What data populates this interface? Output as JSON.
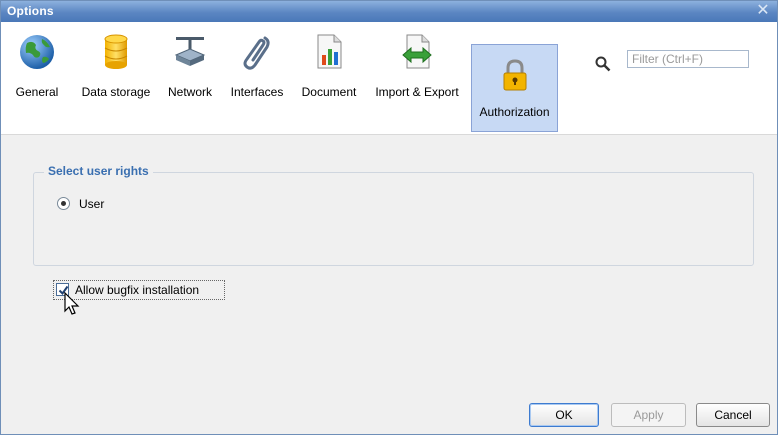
{
  "window": {
    "title": "Options"
  },
  "toolbar": {
    "items": [
      {
        "label": "General",
        "icon": "globe-icon"
      },
      {
        "label": "Data storage",
        "icon": "database-icon"
      },
      {
        "label": "Network",
        "icon": "network-icon"
      },
      {
        "label": "Interfaces",
        "icon": "paperclip-icon"
      },
      {
        "label": "Document",
        "icon": "document-chart-icon"
      },
      {
        "label": "Import & Export",
        "icon": "import-export-icon"
      },
      {
        "label": "Authorization",
        "icon": "lock-icon",
        "selected": true
      }
    ],
    "filter_placeholder": "Filter (Ctrl+F)"
  },
  "user_rights": {
    "group_title": "Select user rights",
    "radio_label": "User",
    "radio_selected": true
  },
  "bugfix": {
    "label": "Allow bugfix installation",
    "checked": true
  },
  "buttons": {
    "ok": "OK",
    "apply": "Apply",
    "cancel": "Cancel"
  },
  "colors": {
    "titlebar": "#5b86c2",
    "selected_tab": "#c7d9f4",
    "group_title": "#3a6fb0"
  }
}
